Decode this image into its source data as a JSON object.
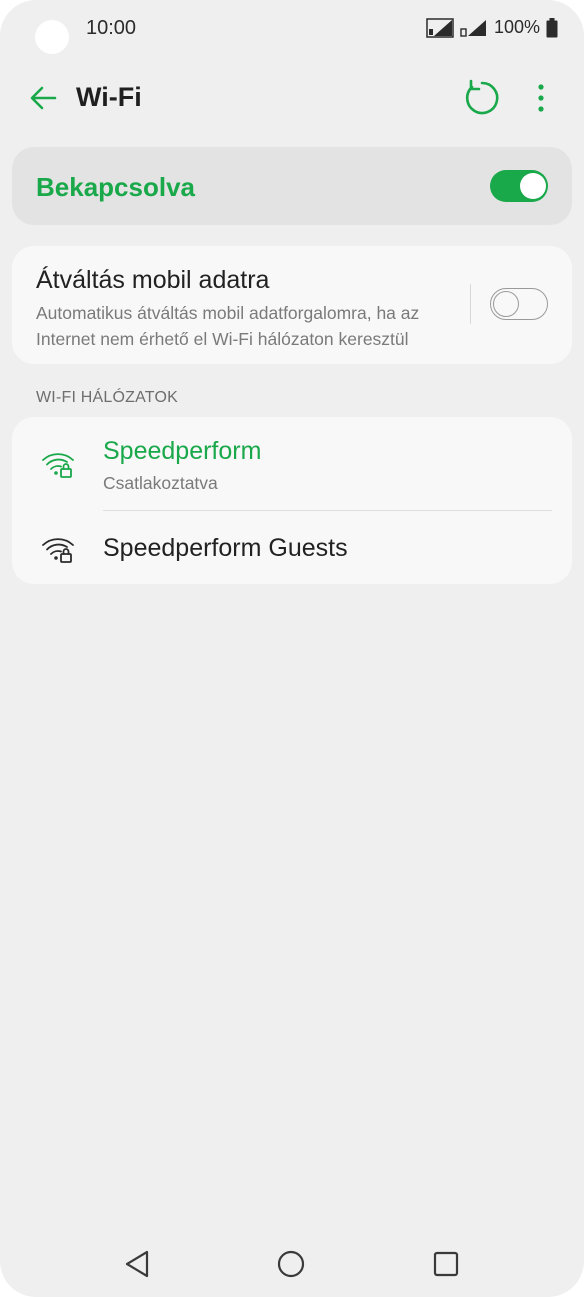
{
  "status_bar": {
    "time": "10:00",
    "battery": "100%"
  },
  "header": {
    "title": "Wi-Fi"
  },
  "master_switch": {
    "label": "Bekapcsolva",
    "state": "on"
  },
  "mobile_data_switch": {
    "title": "Átváltás mobil adatra",
    "description": "Automatikus átváltás mobil adatforgalomra, ha az Internet nem érhető el Wi-Fi hálózaton keresztül",
    "state": "off"
  },
  "networks_section": {
    "label": "WI-FI HÁLÓZATOK",
    "items": [
      {
        "name": "Speedperform",
        "status": "Csatlakoztatva",
        "icon": "wifi-lock-icon"
      },
      {
        "name": "Speedperform Guests",
        "icon": "wifi-lock-icon"
      }
    ]
  },
  "colors": {
    "accent": "#19a84a",
    "background": "#efefef",
    "card": "#f8f8f8",
    "card_highlight": "#e3e3e3"
  },
  "nav": {
    "icons": [
      "back-triangle-icon",
      "home-circle-icon",
      "recents-square-icon"
    ]
  }
}
